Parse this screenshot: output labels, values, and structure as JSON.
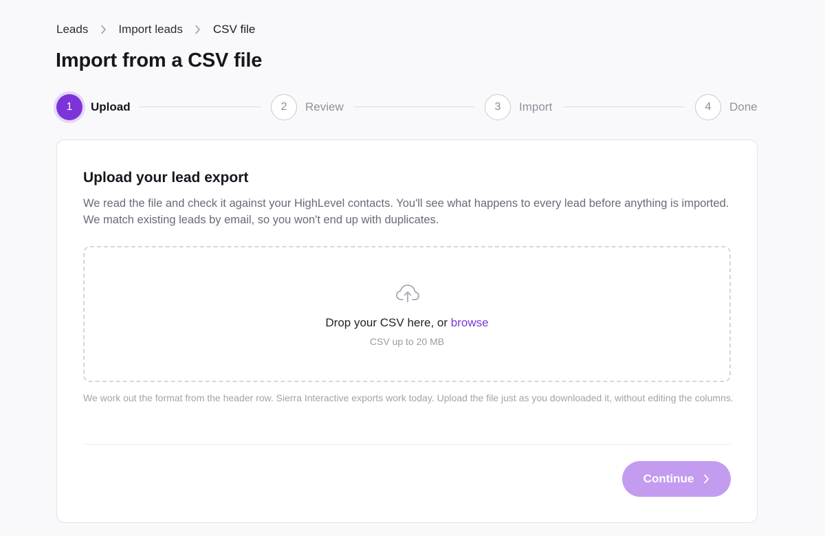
{
  "breadcrumb": {
    "items": [
      {
        "label": "Leads"
      },
      {
        "label": "Import leads"
      },
      {
        "label": "CSV file"
      }
    ],
    "separator_icon": "chevron-right-icon"
  },
  "page": {
    "title": "Import from a CSV file"
  },
  "stepper": {
    "steps": [
      {
        "number": "1",
        "label": "Upload",
        "state": "active"
      },
      {
        "number": "2",
        "label": "Review",
        "state": "pending"
      },
      {
        "number": "3",
        "label": "Import",
        "state": "pending"
      },
      {
        "number": "4",
        "label": "Done",
        "state": "pending"
      }
    ]
  },
  "card": {
    "title": "Upload your lead export",
    "description": "We read the file and check it against your HighLevel contacts. You'll see what happens to every lead before anything is imported. We match existing leads by email, so you won't end up with duplicates.",
    "dropzone": {
      "icon": "cloud-upload-icon",
      "text": "Drop your CSV here, or",
      "browse_label": "browse",
      "hint": "CSV up to 20 MB"
    },
    "note": "We work out the format from the header row. Sierra Interactive exports work today. Upload the file just as you downloaded it, without editing the columns.",
    "continue_label": "Continue"
  },
  "colors": {
    "accent": "#7c34d9",
    "button_disabled": "#c39cf0",
    "background": "#f9f9fb"
  }
}
